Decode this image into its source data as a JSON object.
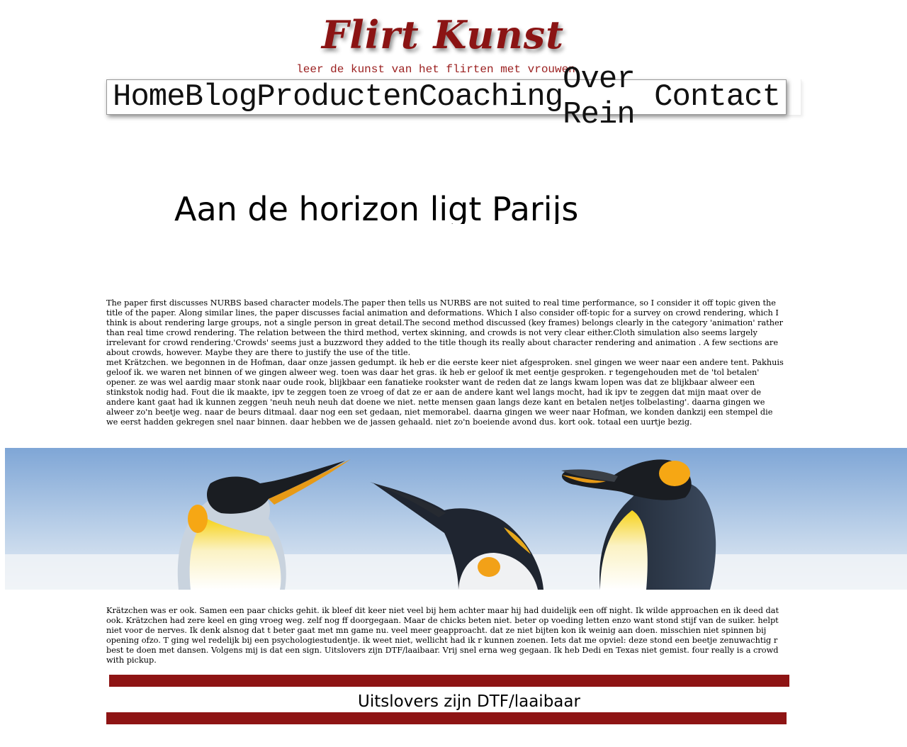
{
  "header": {
    "site_title": "Flirt Kunst",
    "tagline": "leer de kunst van het flirten met vrouwen"
  },
  "nav": {
    "items": [
      "Home",
      "Blog",
      "Producten",
      "Coaching",
      "Over Rein",
      "Contact"
    ]
  },
  "post": {
    "title": "Aan de horizon ligt Parijs",
    "paragraph_1a": "The paper first discusses NURBS based character models.The paper then tells us NURBS are not suited to real time performance, so I consider it off topic given the title of the paper. Along similar lines, the paper discusses facial animation and deformations. Which I also consider off-topic for a survey on crowd rendering, which I think is about rendering large groups, not a single person in great detail.The second method discussed (key frames) belongs clearly in the category 'animation' rather than real time crowd rendering. The relation between the third method, vertex skinning, and crowds is not very clear either.Cloth simulation also seems largely irrelevant for crowd rendering.'Crowds' seems just a buzzword they added to the title though its really about character rendering and animation . A few sections are about crowds, however. Maybe they are there to justify the use of the title.",
    "paragraph_1b": "met Krätzchen. we begonnen in de Hofman, daar onze jassen gedumpt. ik heb er die eerste keer niet afgesproken. snel gingen we weer naar een andere tent. Pakhuis geloof ik. we waren net binnen of we gingen alweer weg. toen was daar het gras. ik heb er geloof ik met eentje gesproken. r tegengehouden met de 'tol betalen' opener. ze was wel aardig maar stonk naar oude rook, blijkbaar een fanatieke rookster want de reden dat ze langs kwam lopen was dat ze blijkbaar alweer een stinkstok nodig had. Fout die ik maakte, ipv te zeggen toen ze vroeg of dat ze er aan de andere kant wel langs mocht, had ik ipv te zeggen dat mijn maat over de andere kant gaat had ik kunnen zeggen 'neuh neuh neuh dat doene we niet. nette mensen gaan langs deze kant en betalen netjes tolbelasting'. daarna gingen we alweer zo'n beetje weg. naar de beurs ditmaal. daar nog een set gedaan, niet memorabel. daarna gingen we weer naar Hofman, we konden dankzij een stempel die we eerst hadden gekregen snel naar binnen. daar hebben we de jassen gehaald. niet zo'n boeiende avond dus. kort ook. totaal een uurtje bezig.",
    "paragraph_2": "Krätzchen was er ook. Samen een paar chicks gehit. ik bleef dit keer niet veel bij hem achter maar hij had duidelijk een off night. Ik wilde approachen en ik deed dat ook. Krätzchen had zere keel en ging vroeg weg. zelf nog ff doorgegaan. Maar de chicks beten niet. beter op voeding letten enzo want stond stijf van de suiker. helpt niet voor de nerves. Ik denk alsnog dat t beter gaat met mn game nu. veel meer geapproacht. dat ze niet bijten kon ik weinig aan doen. misschien niet spinnen bij opening ofzo. T ging wel redelijk bij een psychologiestudentje. ik weet niet, wellicht had ik r kunnen zoenen. Iets dat me opviel: deze stond een beetje zenuwachtig r best te doen met dansen. Volgens mij is dat een sign. Uitslovers zijn DTF/laaibaar. Vrij snel erna weg gegaan. Ik heb Dedi en Texas niet gemist. four really is a crowd with pickup.",
    "quote": "Uitslovers zijn DTF/laaibaar"
  },
  "banner": {
    "icon": "penguins-image"
  },
  "colors": {
    "brand": "#8b1414",
    "bar": "#8e1414"
  }
}
